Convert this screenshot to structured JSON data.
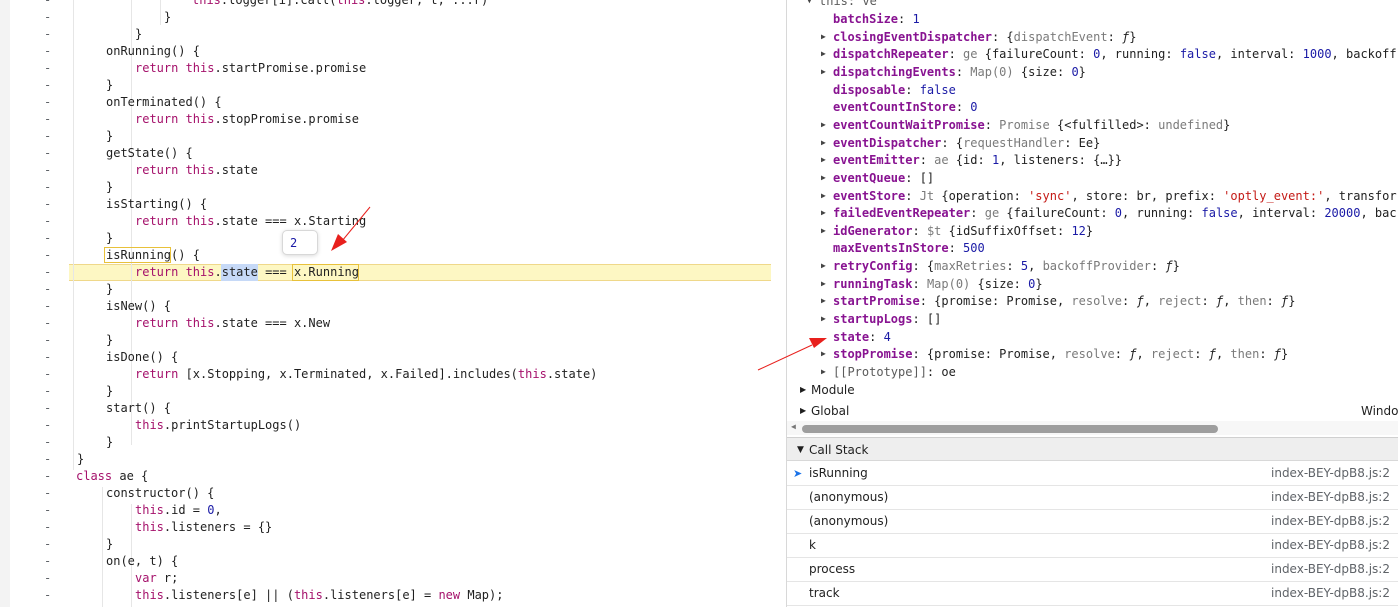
{
  "code": {
    "gutter_mark": "-",
    "lines": [
      [
        {
          "t": "this",
          "c": "kw"
        },
        {
          "t": ".logger[i].call("
        },
        {
          "t": "this",
          "c": "kw"
        },
        {
          "t": ".logger, t, ...r)"
        }
      ],
      [
        {
          "t": "}"
        }
      ],
      [
        {
          "t": "}"
        }
      ],
      [
        {
          "t": "onRunning() {"
        }
      ],
      [
        {
          "t": "return ",
          "c": "kw"
        },
        {
          "t": "this",
          "c": "kw"
        },
        {
          "t": ".startPromise.promise"
        }
      ],
      [
        {
          "t": "}"
        }
      ],
      [
        {
          "t": "onTerminated() {"
        }
      ],
      [
        {
          "t": "return ",
          "c": "kw"
        },
        {
          "t": "this",
          "c": "kw"
        },
        {
          "t": ".stopPromise.promise"
        }
      ],
      [
        {
          "t": "}"
        }
      ],
      [
        {
          "t": "getState() {"
        }
      ],
      [
        {
          "t": "return ",
          "c": "kw"
        },
        {
          "t": "this",
          "c": "kw"
        },
        {
          "t": ".state"
        }
      ],
      [
        {
          "t": "}"
        }
      ],
      [
        {
          "t": "isStarting() {"
        }
      ],
      [
        {
          "t": "return ",
          "c": "kw"
        },
        {
          "t": "this",
          "c": "kw"
        },
        {
          "t": ".state === x.Starting"
        }
      ],
      [
        {
          "t": "}"
        }
      ],
      [
        {
          "t": "isRunning() {"
        }
      ],
      [
        {
          "t": "return ",
          "c": "kw"
        },
        {
          "t": "this",
          "c": "kw"
        },
        {
          "t": "."
        },
        {
          "t": "state"
        },
        {
          "t": " === "
        },
        {
          "t": "x.Running"
        }
      ],
      [
        {
          "t": "}"
        }
      ],
      [
        {
          "t": "isNew() {"
        }
      ],
      [
        {
          "t": "return ",
          "c": "kw"
        },
        {
          "t": "this",
          "c": "kw"
        },
        {
          "t": ".state === x.New"
        }
      ],
      [
        {
          "t": "}"
        }
      ],
      [
        {
          "t": "isDone() {"
        }
      ],
      [
        {
          "t": "return ",
          "c": "kw"
        },
        {
          "t": "[x.Stopping, x.Terminated, x.Failed].includes("
        },
        {
          "t": "this",
          "c": "kw"
        },
        {
          "t": ".state)"
        }
      ],
      [
        {
          "t": "}"
        }
      ],
      [
        {
          "t": "start() {"
        }
      ],
      [
        {
          "t": "this",
          "c": "kw"
        },
        {
          "t": ".printStartupLogs()"
        }
      ],
      [
        {
          "t": "}"
        }
      ],
      [
        {
          "t": "}"
        }
      ],
      [
        {
          "t": "class ",
          "c": "kw"
        },
        {
          "t": "ae {"
        }
      ],
      [
        {
          "t": "constructor() {"
        }
      ],
      [
        {
          "t": "this",
          "c": "kw"
        },
        {
          "t": ".id = "
        },
        {
          "t": "0",
          "c": "var"
        },
        {
          "t": ","
        }
      ],
      [
        {
          "t": "this",
          "c": "kw"
        },
        {
          "t": ".listeners = {}"
        }
      ],
      [
        {
          "t": "}"
        }
      ],
      [
        {
          "t": "on(e, t) {"
        }
      ],
      [
        {
          "t": "var ",
          "c": "kw"
        },
        {
          "t": "r;"
        }
      ],
      [
        {
          "t": "this",
          "c": "kw"
        },
        {
          "t": ".listeners[e] || ("
        },
        {
          "t": "this",
          "c": "kw"
        },
        {
          "t": ".listeners[e] = "
        },
        {
          "t": "new ",
          "c": "kw"
        },
        {
          "t": "Map);"
        }
      ]
    ],
    "tooltip_value": "2"
  },
  "scope": {
    "this_row": "this: ve",
    "props": [
      [
        {
          "t": "batchSize",
          "c": "name"
        },
        {
          "t": ": "
        },
        {
          "t": "1",
          "c": "blue"
        }
      ],
      [
        {
          "t": "closingEventDispatcher",
          "c": "name"
        },
        {
          "t": ": {"
        },
        {
          "t": "dispatchEvent",
          "c": "gray"
        },
        {
          "t": ": "
        },
        {
          "t": "ƒ",
          "c": "fn"
        },
        {
          "t": "}"
        }
      ],
      [
        {
          "t": "dispatchRepeater",
          "c": "name"
        },
        {
          "t": ": "
        },
        {
          "t": "ge",
          "c": "gray"
        },
        {
          "t": " {failureCount: "
        },
        {
          "t": "0",
          "c": "blue"
        },
        {
          "t": ", running: "
        },
        {
          "t": "false",
          "c": "blue"
        },
        {
          "t": ", interval: "
        },
        {
          "t": "1000",
          "c": "blue"
        },
        {
          "t": ", backoff"
        }
      ],
      [
        {
          "t": "dispatchingEvents",
          "c": "name"
        },
        {
          "t": ": "
        },
        {
          "t": "Map(0)",
          "c": "gray"
        },
        {
          "t": " {size: "
        },
        {
          "t": "0",
          "c": "blue"
        },
        {
          "t": "}"
        }
      ],
      [
        {
          "t": "disposable",
          "c": "name"
        },
        {
          "t": ": "
        },
        {
          "t": "false",
          "c": "blue"
        }
      ],
      [
        {
          "t": "eventCountInStore",
          "c": "name"
        },
        {
          "t": ": "
        },
        {
          "t": "0",
          "c": "blue"
        }
      ],
      [
        {
          "t": "eventCountWaitPromise",
          "c": "name"
        },
        {
          "t": ": "
        },
        {
          "t": "Promise",
          "c": "gray"
        },
        {
          "t": " {<fulfilled>: "
        },
        {
          "t": "undefined",
          "c": "gray"
        },
        {
          "t": "}"
        }
      ],
      [
        {
          "t": "eventDispatcher",
          "c": "name"
        },
        {
          "t": ": {"
        },
        {
          "t": "requestHandler",
          "c": "gray"
        },
        {
          "t": ": Ee}"
        }
      ],
      [
        {
          "t": "eventEmitter",
          "c": "name"
        },
        {
          "t": ": "
        },
        {
          "t": "ae",
          "c": "gray"
        },
        {
          "t": " {id: "
        },
        {
          "t": "1",
          "c": "blue"
        },
        {
          "t": ", listeners: {…}}"
        }
      ],
      [
        {
          "t": "eventQueue",
          "c": "name"
        },
        {
          "t": ": []"
        }
      ],
      [
        {
          "t": "eventStore",
          "c": "name"
        },
        {
          "t": ": "
        },
        {
          "t": "Jt",
          "c": "gray"
        },
        {
          "t": " {operation: "
        },
        {
          "t": "'sync'",
          "c": "strv"
        },
        {
          "t": ", store: br, prefix: "
        },
        {
          "t": "'optly_event:'",
          "c": "strv"
        },
        {
          "t": ", transfor"
        }
      ],
      [
        {
          "t": "failedEventRepeater",
          "c": "name"
        },
        {
          "t": ": "
        },
        {
          "t": "ge",
          "c": "gray"
        },
        {
          "t": " {failureCount: "
        },
        {
          "t": "0",
          "c": "blue"
        },
        {
          "t": ", running: "
        },
        {
          "t": "false",
          "c": "blue"
        },
        {
          "t": ", interval: "
        },
        {
          "t": "20000",
          "c": "blue"
        },
        {
          "t": ", bac"
        }
      ],
      [
        {
          "t": "idGenerator",
          "c": "name"
        },
        {
          "t": ": "
        },
        {
          "t": "$t",
          "c": "gray"
        },
        {
          "t": " {idSuffixOffset: "
        },
        {
          "t": "12",
          "c": "blue"
        },
        {
          "t": "}"
        }
      ],
      [
        {
          "t": "maxEventsInStore",
          "c": "name"
        },
        {
          "t": ": "
        },
        {
          "t": "500",
          "c": "blue"
        }
      ],
      [
        {
          "t": "retryConfig",
          "c": "name"
        },
        {
          "t": ": {"
        },
        {
          "t": "maxRetries",
          "c": "gray"
        },
        {
          "t": ": "
        },
        {
          "t": "5",
          "c": "blue"
        },
        {
          "t": ", "
        },
        {
          "t": "backoffProvider",
          "c": "gray"
        },
        {
          "t": ": "
        },
        {
          "t": "ƒ",
          "c": "fn"
        },
        {
          "t": "}"
        }
      ],
      [
        {
          "t": "runningTask",
          "c": "name"
        },
        {
          "t": ": "
        },
        {
          "t": "Map(0)",
          "c": "gray"
        },
        {
          "t": " {size: "
        },
        {
          "t": "0",
          "c": "blue"
        },
        {
          "t": "}"
        }
      ],
      [
        {
          "t": "startPromise",
          "c": "name"
        },
        {
          "t": ": {promise: Promise, "
        },
        {
          "t": "resolve",
          "c": "gray"
        },
        {
          "t": ": "
        },
        {
          "t": "ƒ",
          "c": "fn"
        },
        {
          "t": ", "
        },
        {
          "t": "reject",
          "c": "gray"
        },
        {
          "t": ": "
        },
        {
          "t": "ƒ",
          "c": "fn"
        },
        {
          "t": ", "
        },
        {
          "t": "then",
          "c": "gray"
        },
        {
          "t": ": "
        },
        {
          "t": "ƒ",
          "c": "fn"
        },
        {
          "t": "}"
        }
      ],
      [
        {
          "t": "startupLogs",
          "c": "name"
        },
        {
          "t": ": []"
        }
      ],
      [
        {
          "t": "state",
          "c": "name"
        },
        {
          "t": ": "
        },
        {
          "t": "4",
          "c": "blue"
        }
      ],
      [
        {
          "t": "stopPromise",
          "c": "name"
        },
        {
          "t": ": {promise: Promise, "
        },
        {
          "t": "resolve",
          "c": "gray"
        },
        {
          "t": ": "
        },
        {
          "t": "ƒ",
          "c": "fn"
        },
        {
          "t": ", "
        },
        {
          "t": "reject",
          "c": "gray"
        },
        {
          "t": ": "
        },
        {
          "t": "ƒ",
          "c": "fn"
        },
        {
          "t": ", "
        },
        {
          "t": "then",
          "c": "gray"
        },
        {
          "t": ": "
        },
        {
          "t": "ƒ",
          "c": "fn"
        },
        {
          "t": "}"
        }
      ],
      [
        {
          "t": "[[Prototype]]",
          "c": "nonenum"
        },
        {
          "t": ": oe"
        }
      ]
    ],
    "module_label": "Module",
    "global_label": "Global",
    "global_value": "Windo"
  },
  "callstack": {
    "title": "Call Stack",
    "frames": [
      {
        "name": "isRunning",
        "location": "index-BEY-dpB8.js:2",
        "current": true
      },
      {
        "name": "(anonymous)",
        "location": "index-BEY-dpB8.js:2",
        "current": false
      },
      {
        "name": "(anonymous)",
        "location": "index-BEY-dpB8.js:2",
        "current": false
      },
      {
        "name": "k",
        "location": "index-BEY-dpB8.js:2",
        "current": false
      },
      {
        "name": "process",
        "location": "index-BEY-dpB8.js:2",
        "current": false
      },
      {
        "name": "track",
        "location": "index-BEY-dpB8.js:2",
        "current": false
      }
    ]
  },
  "colors": {
    "keyword": "#a5116b",
    "property_name": "#881391",
    "number": "#1a1aa6",
    "string": "#c41a16",
    "highlight_line": "#fdf7c3",
    "annotation_arrow": "#e8201d"
  },
  "icons": [
    "triangle-right-icon",
    "triangle-down-icon",
    "current-frame-arrow-icon",
    "annotation-arrow"
  ]
}
